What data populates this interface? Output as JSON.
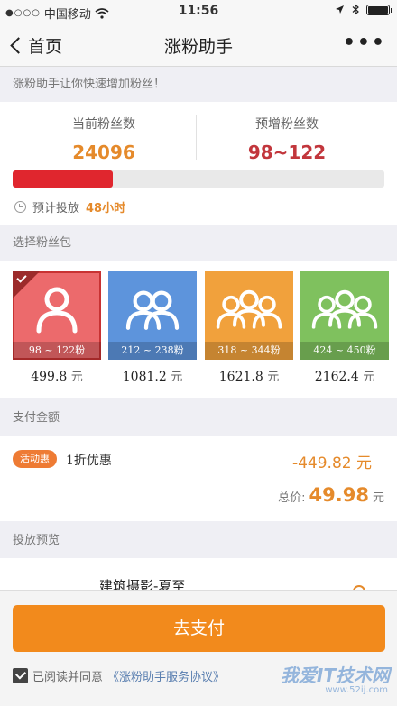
{
  "status_bar": {
    "signal_dots": "●○○○",
    "carrier": "中国移动",
    "time": "11:56"
  },
  "nav": {
    "back_label": "首页",
    "title": "涨粉助手",
    "more_label": "•••"
  },
  "intro_text": "涨粉助手让你快速增加粉丝！",
  "stats": {
    "current_label": "当前粉丝数",
    "current_value": "24096",
    "current_color": "#e58a2b",
    "expected_label": "预增粉丝数",
    "expected_value": "98~122",
    "expected_color": "#c2363c",
    "progress_fraction": 0.27,
    "eta_label": "预计投放",
    "eta_value": "48小时"
  },
  "packages_section_label": "选择粉丝包",
  "packages": [
    {
      "range": "98 ~ 122粉",
      "price": "499.8",
      "unit": "元",
      "color": "#ec6a6c",
      "people": 1,
      "selected": true
    },
    {
      "range": "212 ~ 238粉",
      "price": "1081.2",
      "unit": "元",
      "color": "#5d94dc",
      "people": 2,
      "selected": false
    },
    {
      "range": "318 ~ 344粉",
      "price": "1621.8",
      "unit": "元",
      "color": "#f1a13c",
      "people": 3,
      "selected": false
    },
    {
      "range": "424 ~ 450粉",
      "price": "2162.4",
      "unit": "元",
      "color": "#7fc15e",
      "people": 3,
      "selected": false
    }
  ],
  "payment": {
    "section_label": "支付金额",
    "promo_tag": "活动惠",
    "promo_text": "1折优惠",
    "discount": "-449.82 元",
    "total_label": "总价:",
    "total_value": "49.98",
    "total_unit": "元"
  },
  "preview": {
    "section_label": "投放预览",
    "account_name": "建筑摄影-夏至"
  },
  "bottom": {
    "pay_label": "去支付",
    "agree_text": "已阅读并同意",
    "agreement_link": "《涨粉助手服务协议》",
    "watermark": "我爱IT技术网",
    "watermark_sub": "www.52ij.com"
  }
}
